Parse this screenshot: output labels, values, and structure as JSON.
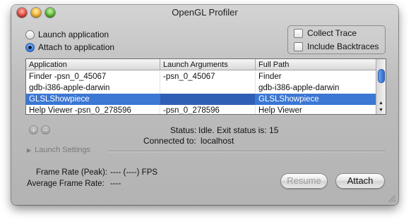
{
  "window": {
    "title": "OpenGL Profiler"
  },
  "target_mode": {
    "options": [
      "Launch application",
      "Attach to application"
    ],
    "selected": "Attach to application"
  },
  "trace_options": {
    "collect_trace": {
      "label": "Collect Trace",
      "checked": false
    },
    "include_backtraces": {
      "label": "Include Backtraces",
      "checked": false
    }
  },
  "table": {
    "columns": [
      "Application",
      "Launch Arguments",
      "Full Path"
    ],
    "rows": [
      {
        "app": "Finder -psn_0_45067",
        "args": "-psn_0_45067",
        "path": "Finder",
        "selected": false
      },
      {
        "app": "gdb-i386-apple-darwin",
        "args": "",
        "path": "gdb-i386-apple-darwin",
        "selected": false
      },
      {
        "app": "GLSLShowpiece",
        "args": "",
        "path": "GLSLShowpiece",
        "selected": true
      },
      {
        "app": "Help Viewer -psn_0_278596",
        "args": "-psn_0_278596",
        "path": "Help Viewer",
        "selected": false
      }
    ]
  },
  "list_controls": {
    "add_icon": "plus-icon",
    "remove_icon": "minus-icon"
  },
  "status": {
    "status_label": "Status:",
    "status_value": "Idle. Exit status is: 15",
    "connected_label": "Connected to:",
    "connected_value": "localhost"
  },
  "launch_settings": {
    "label": "Launch Settings"
  },
  "stats": {
    "frame_rate_peak_label": "Frame Rate (Peak):",
    "frame_rate_peak_value": "---- (----) FPS",
    "average_frame_rate_label": "Average Frame Rate:",
    "average_frame_rate_value": "----"
  },
  "buttons": {
    "resume": "Resume",
    "attach": "Attach"
  },
  "colors": {
    "selection": "#3b77d3",
    "window": "#bdbdbd"
  }
}
